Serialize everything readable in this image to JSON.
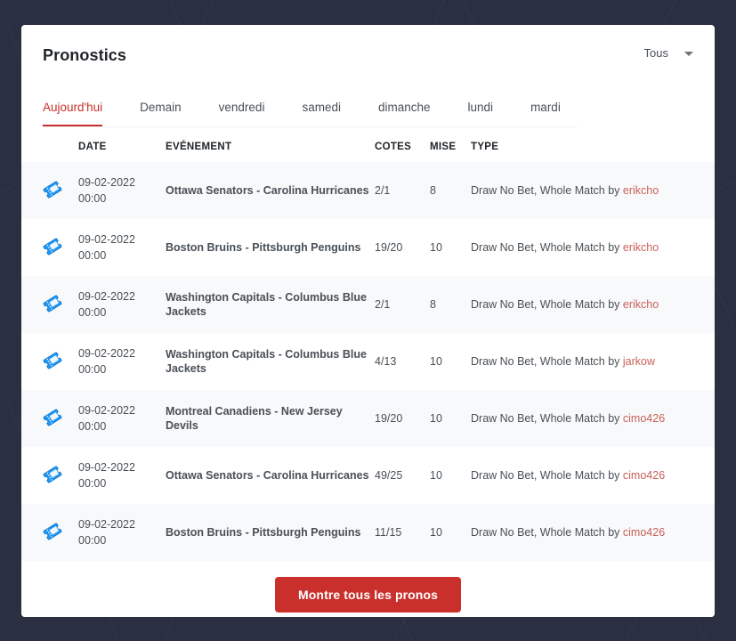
{
  "header": {
    "title": "Pronostics",
    "filter": {
      "label": "Tous",
      "icon": "chevron-down-icon"
    }
  },
  "tabs": [
    {
      "label": "Aujourd'hui",
      "active": true
    },
    {
      "label": "Demain",
      "active": false
    },
    {
      "label": "vendredi",
      "active": false
    },
    {
      "label": "samedi",
      "active": false
    },
    {
      "label": "dimanche",
      "active": false
    },
    {
      "label": "lundi",
      "active": false
    },
    {
      "label": "mardi",
      "active": false
    }
  ],
  "table": {
    "columns": [
      "",
      "DATE",
      "EVÉNEMENT",
      "COTES",
      "MISE",
      "TYPE"
    ],
    "rows": [
      {
        "icon": "ticket-icon",
        "date": "09-02-2022\n00:00",
        "event": "Ottawa Senators - Carolina Hurricanes",
        "cotes": "2/1",
        "mise": "8",
        "type_prefix": "Draw No Bet, Whole Match by ",
        "author": "erikcho"
      },
      {
        "icon": "ticket-icon",
        "date": "09-02-2022\n00:00",
        "event": "Boston Bruins - Pittsburgh Penguins",
        "cotes": "19/20",
        "mise": "10",
        "type_prefix": "Draw No Bet, Whole Match by ",
        "author": "erikcho"
      },
      {
        "icon": "ticket-icon",
        "date": "09-02-2022\n00:00",
        "event": "Washington Capitals - Columbus Blue Jackets",
        "cotes": "2/1",
        "mise": "8",
        "type_prefix": "Draw No Bet, Whole Match by ",
        "author": "erikcho"
      },
      {
        "icon": "ticket-icon",
        "date": "09-02-2022\n00:00",
        "event": "Washington Capitals - Columbus Blue Jackets",
        "cotes": "4/13",
        "mise": "10",
        "type_prefix": "Draw No Bet, Whole Match by ",
        "author": "jarkow"
      },
      {
        "icon": "ticket-icon",
        "date": "09-02-2022\n00:00",
        "event": "Montreal Canadiens - New Jersey Devils",
        "cotes": "19/20",
        "mise": "10",
        "type_prefix": "Draw No Bet, Whole Match by ",
        "author": "cimo426"
      },
      {
        "icon": "ticket-icon",
        "date": "09-02-2022\n00:00",
        "event": "Ottawa Senators - Carolina Hurricanes",
        "cotes": "49/25",
        "mise": "10",
        "type_prefix": "Draw No Bet, Whole Match by ",
        "author": "cimo426"
      },
      {
        "icon": "ticket-icon",
        "date": "09-02-2022\n00:00",
        "event": "Boston Bruins - Pittsburgh Penguins",
        "cotes": "11/15",
        "mise": "10",
        "type_prefix": "Draw No Bet, Whole Match by ",
        "author": "cimo426"
      }
    ]
  },
  "footer": {
    "show_all_label": "Montre tous les pronos"
  },
  "colors": {
    "page_background": "#2a3042",
    "card_background": "#ffffff",
    "accent_red": "#c9302c",
    "author_red": "#c9605a",
    "stripe_gray": "#f8f9fa",
    "ticket_blue": "#1e90e8",
    "text_dark": "#212529",
    "text_muted": "#495057"
  }
}
